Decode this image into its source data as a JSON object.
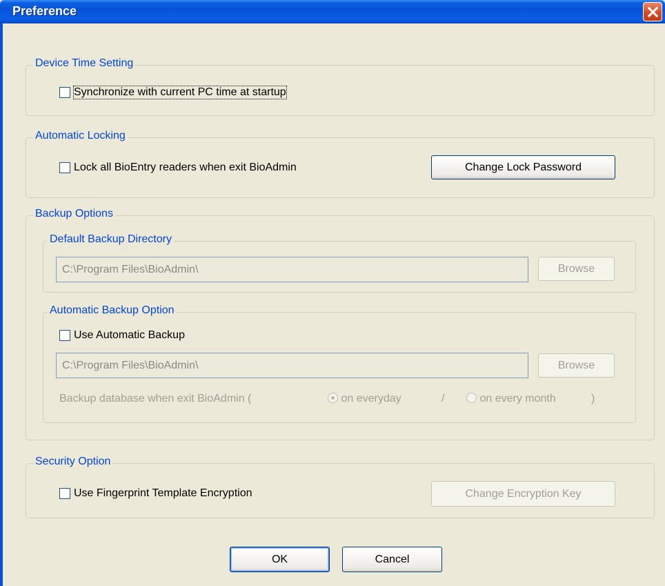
{
  "window": {
    "title": "Preference"
  },
  "device_time": {
    "legend": "Device Time Setting",
    "sync_label": "Synchronize with current PC time at startup",
    "sync_checked": false
  },
  "auto_lock": {
    "legend": "Automatic Locking",
    "lock_label": "Lock all BioEntry readers when exit BioAdmin",
    "lock_checked": false,
    "change_password_label": "Change Lock Password"
  },
  "backup": {
    "legend": "Backup Options",
    "default_dir": {
      "legend": "Default Backup Directory",
      "path": "C:\\Program Files\\BioAdmin\\",
      "browse_label": "Browse"
    },
    "auto": {
      "legend": "Automatic Backup Option",
      "use_label": "Use Automatic Backup",
      "use_checked": false,
      "path": "C:\\Program Files\\BioAdmin\\",
      "browse_label": "Browse",
      "when_label": "Backup database when exit BioAdmin  (",
      "everyday_label": "on everyday",
      "separator": "/",
      "every_month_label": "on every month",
      "close_paren": ")",
      "selected": "on everyday"
    }
  },
  "security": {
    "legend": "Security Option",
    "encrypt_label": "Use Fingerprint Template Encryption",
    "encrypt_checked": false,
    "change_key_label": "Change Encryption Key"
  },
  "footer": {
    "ok_label": "OK",
    "cancel_label": "Cancel"
  },
  "colors": {
    "title_bar": "#0854d8",
    "legend_text": "#0046d5",
    "background": "#ece9d8",
    "close_button": "#d8502a"
  },
  "icons": {
    "close": "close-icon"
  }
}
